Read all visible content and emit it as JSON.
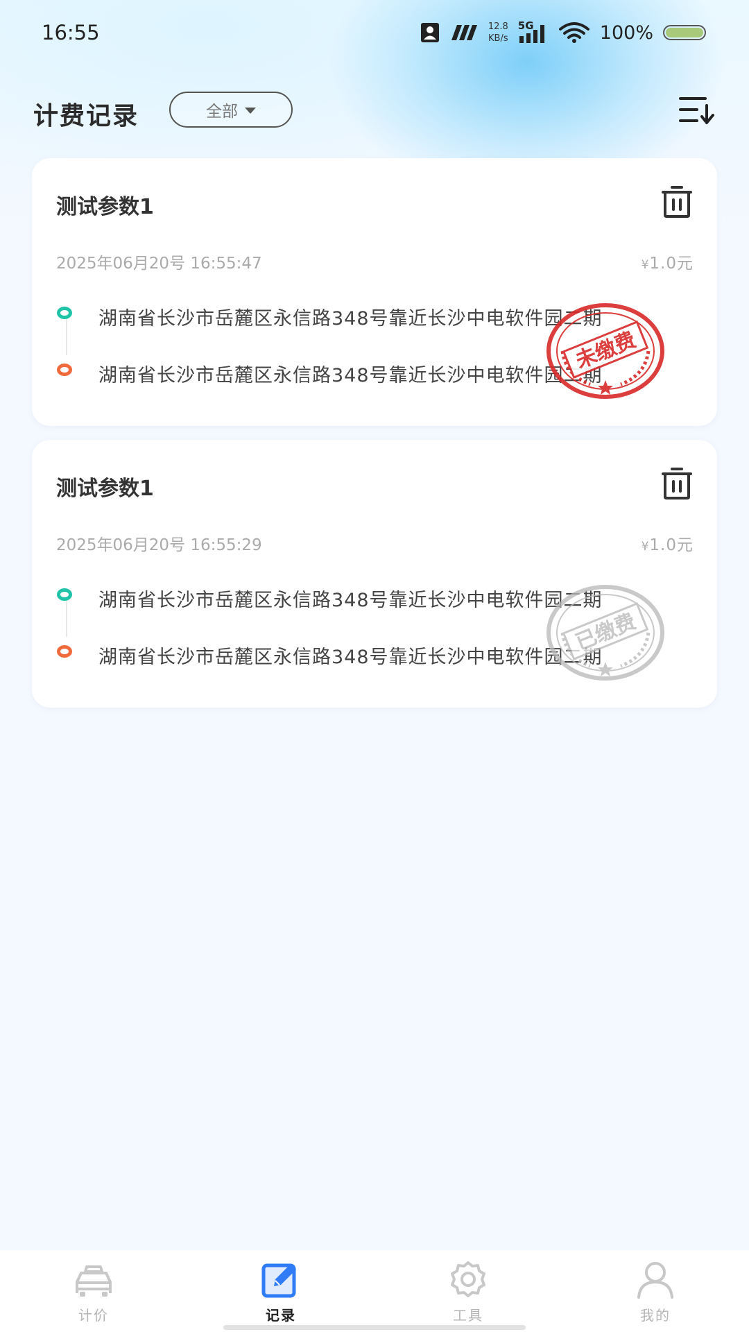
{
  "status_bar": {
    "time": "16:55",
    "net_speed_value": "12.8",
    "net_speed_unit": "KB/s",
    "network_type": "5G",
    "battery_text": "100%",
    "battery_level": 1.0
  },
  "header": {
    "title": "计费记录",
    "filter_label": "全部"
  },
  "records": [
    {
      "title": "测试参数1",
      "time": "2025年06月20号 16:55:47",
      "price_symbol": "¥",
      "price": "1.0元",
      "start_address": "湖南省长沙市岳麓区永信路348号靠近长沙中电软件园二期",
      "end_address": "湖南省长沙市岳麓区永信路348号靠近长沙中电软件园二期",
      "stamp_text": "未缴费",
      "stamp_color": "#d92a2a"
    },
    {
      "title": "测试参数1",
      "time": "2025年06月20号 16:55:29",
      "price_symbol": "¥",
      "price": "1.0元",
      "start_address": "湖南省长沙市岳麓区永信路348号靠近长沙中电软件园二期",
      "end_address": "湖南省长沙市岳麓区永信路348号靠近长沙中电软件园二期",
      "stamp_text": "已缴费",
      "stamp_color": "#b8b8b8"
    }
  ],
  "bottom_nav": {
    "items": [
      {
        "label": "计价",
        "icon": "taxi-icon",
        "active": false
      },
      {
        "label": "记录",
        "icon": "edit-record-icon",
        "active": true
      },
      {
        "label": "工具",
        "icon": "gear-icon",
        "active": false
      },
      {
        "label": "我的",
        "icon": "user-icon",
        "active": false
      }
    ]
  },
  "colors": {
    "accent": "#2f7cf6",
    "start_dot": "#20c3a7",
    "end_dot": "#f06a3c"
  }
}
